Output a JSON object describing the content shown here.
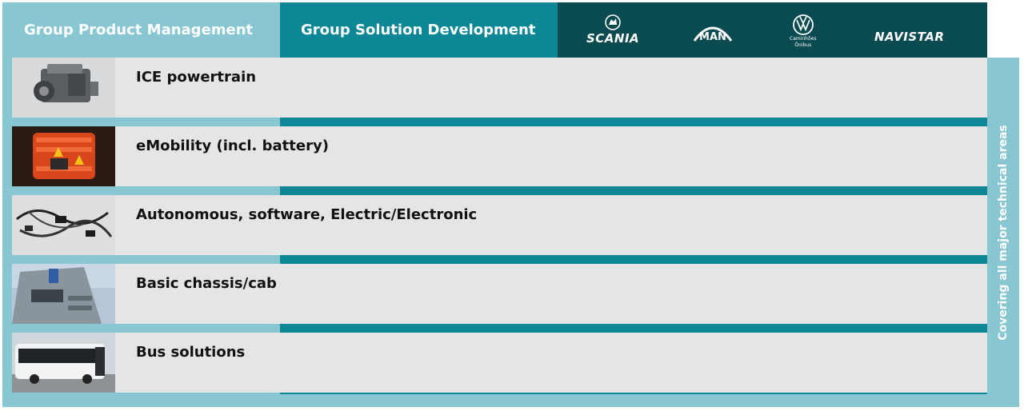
{
  "header": {
    "group_product_management": "Group Product Management",
    "group_solution_development": "Group Solution Development"
  },
  "brands": {
    "scania": "SCANIA",
    "man": "MAN",
    "vw_line1": "Caminhões",
    "vw_line2": "Ônibus",
    "navistar": "NAVISTAR"
  },
  "rows": [
    {
      "label": "ICE powertrain",
      "image": "engine-photo"
    },
    {
      "label": "eMobility (incl. battery)",
      "image": "electric-motor-photo"
    },
    {
      "label": "Autonomous, software, Electric/Electronic",
      "image": "wiring-harness-photo"
    },
    {
      "label": "Basic chassis/cab",
      "image": "truck-cab-photo"
    },
    {
      "label": "Bus solutions",
      "image": "bus-photo"
    }
  ],
  "side_label": "Covering all major technical areas",
  "colors": {
    "light_teal": "#88c7d1",
    "mid_teal": "#0d8796",
    "dark_teal": "#0a4a51",
    "row_gray": "#e4e5e6"
  }
}
